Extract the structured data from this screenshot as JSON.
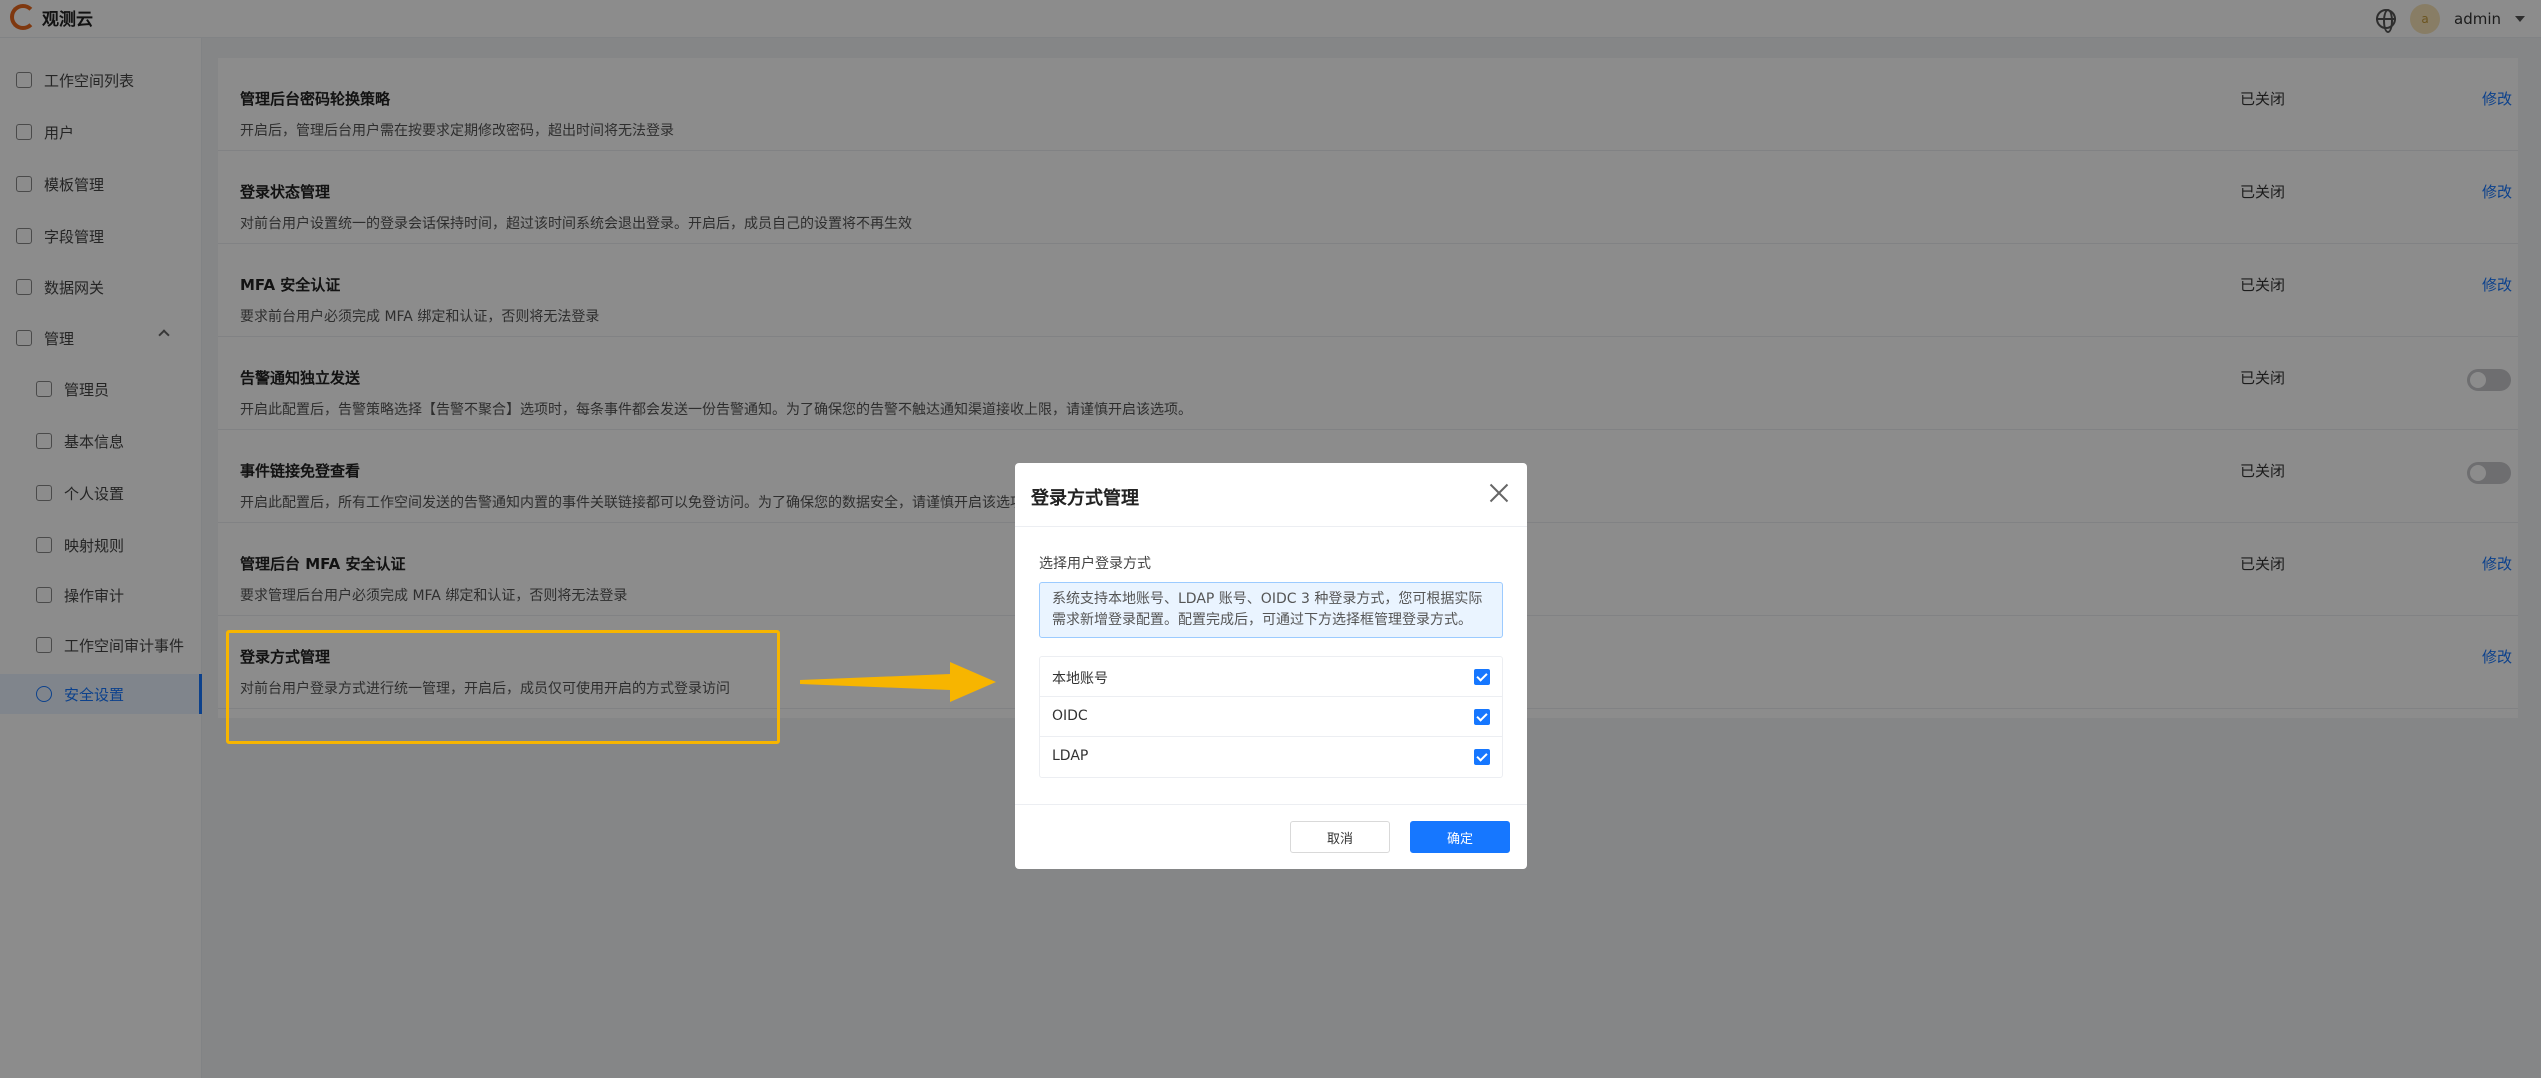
{
  "app": {
    "name": "观测云"
  },
  "header": {
    "user": "admin",
    "avatar_text": "a"
  },
  "sidebar": {
    "items": [
      {
        "label": "工作空间列表"
      },
      {
        "label": "用户"
      },
      {
        "label": "模板管理"
      },
      {
        "label": "字段管理"
      },
      {
        "label": "数据网关"
      },
      {
        "label": "管理"
      },
      {
        "label": "管理员"
      },
      {
        "label": "基本信息"
      },
      {
        "label": "个人设置"
      },
      {
        "label": "映射规则"
      },
      {
        "label": "操作审计"
      },
      {
        "label": "工作空间审计事件"
      },
      {
        "label": "安全设置"
      }
    ]
  },
  "settings": {
    "rows": [
      {
        "title": "管理后台密码轮换策略",
        "desc": "开启后，管理后台用户需在按要求定期修改密码，超出时间将无法登录",
        "status": "已关闭",
        "action": "修改"
      },
      {
        "title": "登录状态管理",
        "desc": "对前台用户设置统一的登录会话保持时间，超过该时间系统会退出登录。开启后，成员自己的设置将不再生效",
        "status": "已关闭",
        "action": "修改"
      },
      {
        "title": "MFA 安全认证",
        "desc": "要求前台用户必须完成 MFA 绑定和认证，否则将无法登录",
        "status": "已关闭",
        "action": "修改"
      },
      {
        "title": "告警通知独立发送",
        "desc": "开启此配置后，告警策略选择【告警不聚合】选项时，每条事件都会发送一份告警通知。为了确保您的告警不触达通知渠道接收上限，请谨慎开启该选项。",
        "status": "已关闭",
        "action": ""
      },
      {
        "title": "事件链接免登查看",
        "desc": "开启此配置后，所有工作空间发送的告警通知内置的事件关联链接都可以免登访问。为了确保您的数据安全，请谨慎开启该选项。",
        "status": "已关闭",
        "action": ""
      },
      {
        "title": "管理后台 MFA 安全认证",
        "desc": "要求管理后台用户必须完成 MFA 绑定和认证，否则将无法登录",
        "status": "已关闭",
        "action": "修改"
      },
      {
        "title": "登录方式管理",
        "desc": "对前台用户登录方式进行统一管理，开启后，成员仅可使用开启的方式登录访问",
        "status": "",
        "action": "修改"
      }
    ]
  },
  "modal": {
    "title": "登录方式管理",
    "section_label": "选择用户登录方式",
    "info_line1": "系统支持本地账号、LDAP 账号、OIDC 3 种登录方式，您可根据实际",
    "info_line2": "需求新增登录配置。配置完成后，可通过下方选择框管理登录方式。",
    "options": [
      {
        "label": "本地账号",
        "checked": true
      },
      {
        "label": "OIDC",
        "checked": true
      },
      {
        "label": "LDAP",
        "checked": true
      }
    ],
    "cancel_label": "取消",
    "ok_label": "确定"
  },
  "colors": {
    "primary": "#1677ff",
    "highlight": "#f7b500",
    "brand": "#e8671d"
  }
}
